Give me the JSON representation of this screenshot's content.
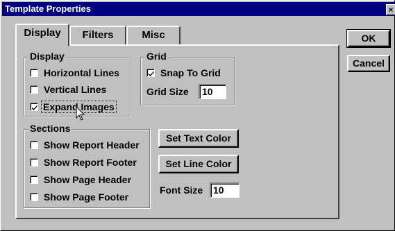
{
  "window": {
    "title": "Template Properties",
    "close_glyph": "×"
  },
  "tabs": [
    {
      "label": "Display",
      "active": true
    },
    {
      "label": "Filters",
      "active": false
    },
    {
      "label": "Misc",
      "active": false
    }
  ],
  "buttons": {
    "ok": "OK",
    "cancel": "Cancel",
    "set_text_color": "Set Text Color",
    "set_line_color": "Set Line Color"
  },
  "display_group": {
    "label": "Display",
    "items": [
      {
        "label": "Horizontal Lines",
        "checked": false
      },
      {
        "label": "Vertical Lines",
        "checked": false
      },
      {
        "label": "Expand Images",
        "checked": true
      }
    ]
  },
  "grid_group": {
    "label": "Grid",
    "snap": {
      "label": "Snap To Grid",
      "checked": true
    },
    "size_label": "Grid Size",
    "size_value": "10"
  },
  "sections_group": {
    "label": "Sections",
    "items": [
      {
        "label": "Show Report Header",
        "checked": false
      },
      {
        "label": "Show Report Footer",
        "checked": false
      },
      {
        "label": "Show Page Header",
        "checked": false
      },
      {
        "label": "Show Page Footer",
        "checked": false
      }
    ]
  },
  "font": {
    "label": "Font Size",
    "value": "10"
  },
  "icons": {
    "check": "check-icon",
    "cursor": "arrow-cursor-icon",
    "close": "close-icon"
  }
}
